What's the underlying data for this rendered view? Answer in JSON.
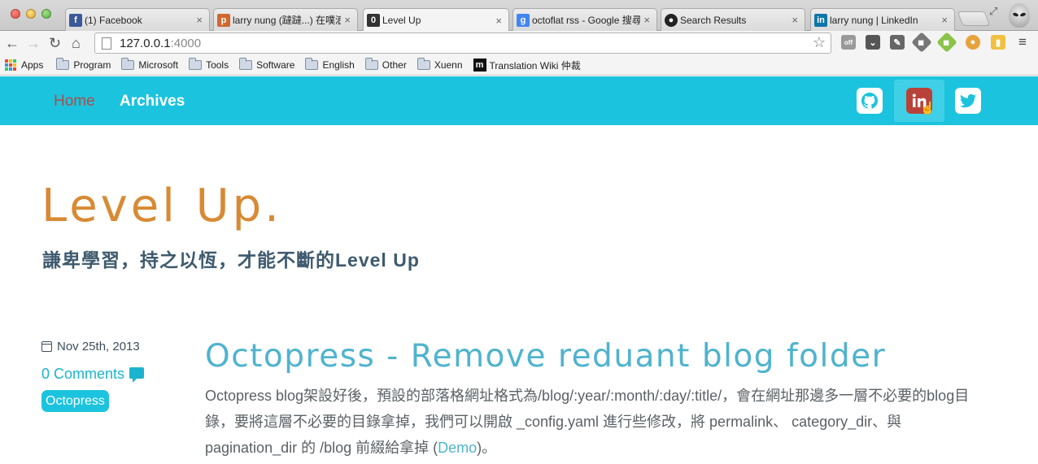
{
  "browser": {
    "tabs": [
      {
        "title": "(1) Facebook",
        "icon": "facebook-icon",
        "color": "#3b5998",
        "glyph": "f"
      },
      {
        "title": "larry nung (躂躂...) 在噗浪",
        "icon": "plurk-icon",
        "color": "#cf682f",
        "glyph": "p"
      },
      {
        "title": "Level Up",
        "icon": "octopress-icon",
        "color": "#333333",
        "glyph": "0"
      },
      {
        "title": "octoflat rss - Google 搜尋",
        "icon": "google-icon",
        "color": "#4285f4",
        "glyph": "g"
      },
      {
        "title": "Search Results",
        "icon": "github-icon",
        "color": "#222222",
        "glyph": "●"
      },
      {
        "title": "larry nung | LinkedIn",
        "icon": "linkedin-icon",
        "color": "#0e76a8",
        "glyph": "in"
      }
    ],
    "active_tab": 2,
    "tab_close": "×",
    "url_host": "127.0.0.1",
    "url_port": ":4000",
    "ext_badge": "off",
    "bookmarks": {
      "apps": "Apps",
      "folders": [
        "Program",
        "Microsoft",
        "Tools",
        "Software",
        "English",
        "Other",
        "Xuenn"
      ],
      "wiki": "Translation Wiki 仲裁",
      "wiki_glyph": "m"
    }
  },
  "site": {
    "nav": {
      "home": "Home",
      "archives": "Archives"
    },
    "social": [
      "github-icon",
      "linkedin-icon",
      "twitter-icon"
    ],
    "title": "Level Up.",
    "subtitle": "謙卑學習，持之以恆，才能不斷的Level Up"
  },
  "post": {
    "date": "Nov 25th, 2013",
    "comments": "0 Comments",
    "tag": "Octopress",
    "title": "Octopress - Remove reduant blog folder",
    "excerpt_before": "Octopress blog架設好後，預設的部落格網址格式為/blog/:year/:month/:day/:title/，會在網址那邊多一層不必要的blog目錄，要將這層不必要的目錄拿掉，我們可以開啟 _config.yaml 進行些修改，將 permalink、 category_dir、與 pagination_dir 的 /blog 前綴給拿掉 (",
    "excerpt_link": "Demo",
    "excerpt_after": ")。"
  },
  "colors": {
    "navbar": "#1cc3de",
    "title": "#d88a34",
    "accent": "#4fb3cf",
    "home_link": "#a85049"
  }
}
